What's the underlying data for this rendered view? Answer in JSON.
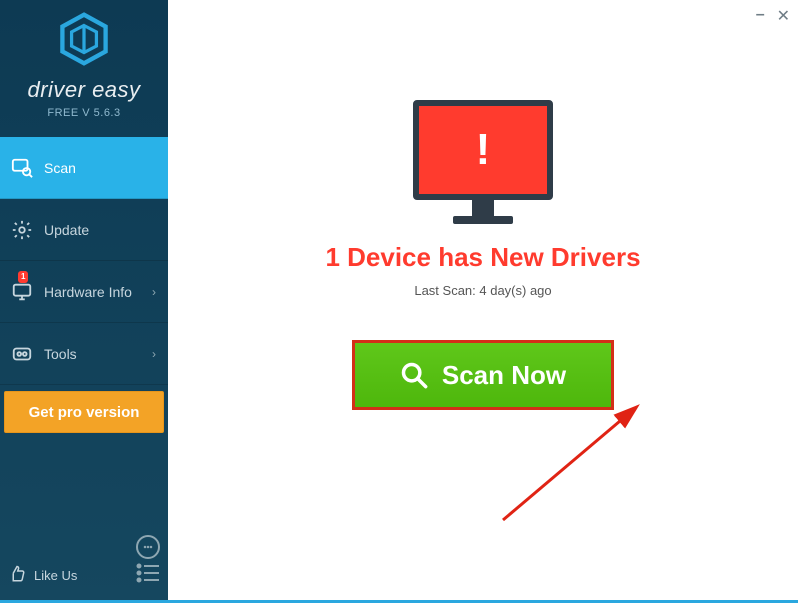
{
  "brand": {
    "name": "driver easy",
    "version": "FREE V 5.6.3"
  },
  "sidebar": {
    "items": [
      {
        "label": "Scan",
        "icon": "scan",
        "active": true,
        "chevron": false,
        "badge": null
      },
      {
        "label": "Update",
        "icon": "update",
        "active": false,
        "chevron": false,
        "badge": null
      },
      {
        "label": "Hardware Info",
        "icon": "hardware",
        "active": false,
        "chevron": true,
        "badge": "1"
      },
      {
        "label": "Tools",
        "icon": "tools",
        "active": false,
        "chevron": true,
        "badge": null
      }
    ],
    "pro_button": "Get pro version",
    "feedback_tooltip": "Feedback",
    "like_us": "Like Us",
    "menu_tooltip": "Menu"
  },
  "main": {
    "alert_title": "1 Device has New Drivers",
    "last_scan": "Last Scan: 4 day(s) ago",
    "scan_button": "Scan Now"
  },
  "window": {
    "minimize": "–",
    "close": "✕"
  }
}
